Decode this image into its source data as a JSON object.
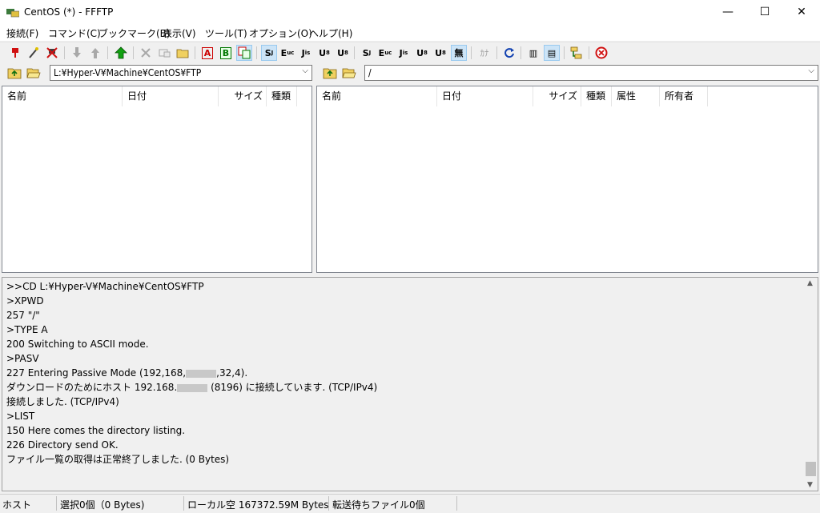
{
  "window": {
    "title": "CentOS (*) - FFFTP",
    "minimize_glyph": "—",
    "maximize_glyph": "☐",
    "close_glyph": "✕"
  },
  "menu": [
    {
      "label": "接続(F)"
    },
    {
      "label": "コマンド(C)"
    },
    {
      "label": "ブックマーク(B)"
    },
    {
      "label": "表示(V)"
    },
    {
      "label": "ツール(T)"
    },
    {
      "label": "オプション(O)"
    },
    {
      "label": "ヘルプ(H)"
    }
  ],
  "toolbar": {
    "connect_icon": "connect-icon",
    "quick_connect_icon": "quick-connect-icon",
    "disconnect_icon": "disconnect-icon",
    "download_icon": "download-arrow-icon",
    "upload_icon": "upload-arrow-icon",
    "mirror_upload_icon": "mirror-upload-icon",
    "delete_icon": "delete-icon",
    "rename_icon": "rename-icon",
    "mkdir_icon": "new-folder-icon",
    "ascii_label": "A",
    "binary_label": "B",
    "sjis_label": "S",
    "euc_label": "E",
    "jis_label": "J",
    "utf8_label": "U",
    "utf8n_label": "U",
    "none_label": "無",
    "kana_label": "ｶﾅ",
    "list_label": "▥",
    "details_label": "▤"
  },
  "local": {
    "path": "L:¥Hyper-V¥Machine¥CentOS¥FTP",
    "columns": [
      "名前",
      "日付",
      "サイズ",
      "種類"
    ]
  },
  "remote": {
    "path": "/",
    "columns": [
      "名前",
      "日付",
      "サイズ",
      "種類",
      "属性",
      "所有者"
    ]
  },
  "log": [
    ">>CD L:¥Hyper-V¥Machine¥CentOS¥FTP",
    ">XPWD",
    "257 \"/\"",
    ">TYPE A",
    "200 Switching to ASCII mode.",
    ">PASV",
    "227 Entering Passive Mode (192,168,",
    "ダウンロードのためにホスト 192.168.",
    "接続しました. (TCP/IPv4)",
    ">LIST",
    "150 Here comes the directory listing.",
    "226 Directory send OK.",
    "ファイル一覧の取得は正常終了しました. (0 Bytes)"
  ],
  "log_tail": {
    "pasv_suffix": ",32,4).",
    "download_suffix": " (8196) に接続しています. (TCP/IPv4)"
  },
  "status": {
    "host": "ホスト",
    "selection": "選択0個（0 Bytes)",
    "local_free": "ローカル空 167372.59M Bytes",
    "queue": "転送待ちファイル0個"
  }
}
